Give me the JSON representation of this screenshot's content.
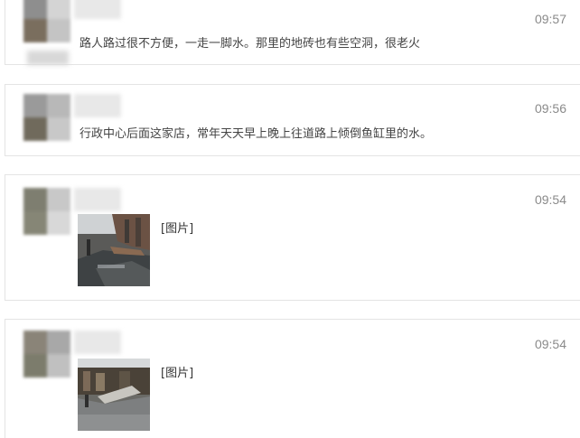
{
  "messages": [
    {
      "time": "09:57",
      "text": "路人路过很不方便，一走一脚水。那里的地砖也有些空洞，很老火",
      "avatar_colors": [
        "#8e8e8e",
        "#d4d4d4",
        "#7a6e5e",
        "#c4c4c4"
      ]
    },
    {
      "time": "09:56",
      "text": "行政中心后面这家店，常年天天早上晚上往道路上倾倒鱼缸里的水。",
      "avatar_colors": [
        "#9a9a9a",
        "#b8b8b8",
        "#706a5c",
        "#c8c8c8"
      ]
    },
    {
      "time": "09:54",
      "photo_label": "[图片]",
      "avatar_colors": [
        "#7e7e70",
        "#c8c8c8",
        "#868676",
        "#d8d8d8"
      ]
    },
    {
      "time": "09:54",
      "photo_label": "[图片]",
      "avatar_colors": [
        "#8a8478",
        "#a8a8a8",
        "#7c7c6c",
        "#c0c0c0"
      ]
    }
  ]
}
